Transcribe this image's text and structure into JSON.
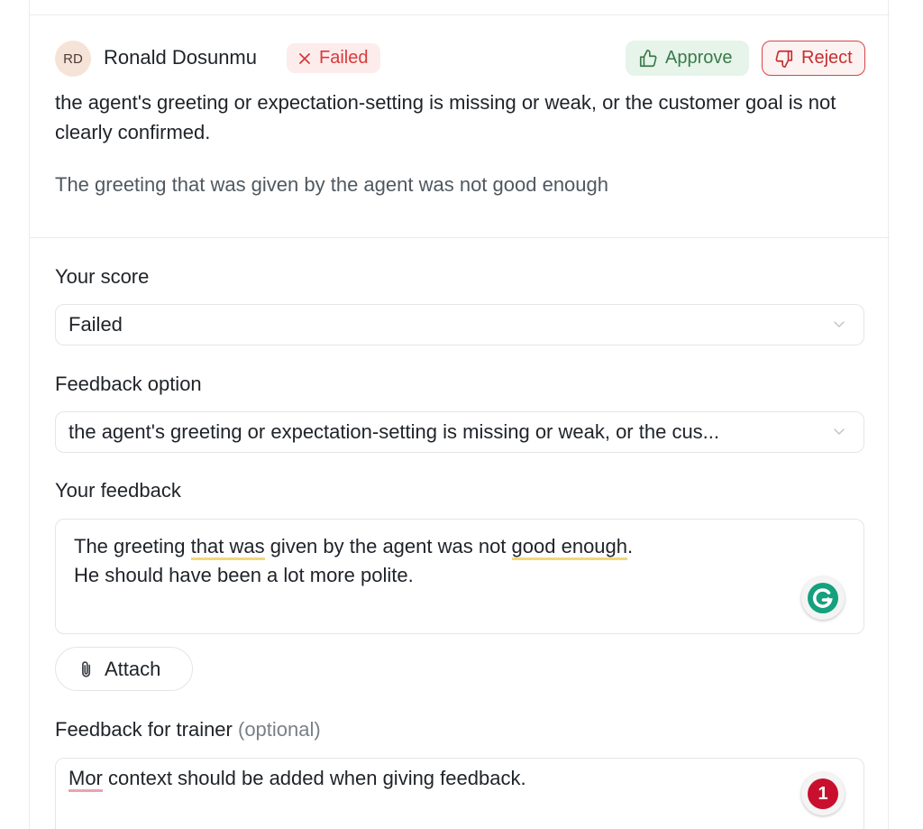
{
  "review": {
    "author_initials": "RD",
    "author_name": "Ronald Dosunmu",
    "status": "Failed",
    "status_icon": "close-icon",
    "approve_label": "Approve",
    "approve_icon": "thumbs-up-icon",
    "reject_label": "Reject",
    "reject_icon": "thumbs-down-icon",
    "headline": "the agent's greeting or expectation-setting is missing or weak, or the customer goal is not clearly confirmed.",
    "comment": "The greeting that was given by the agent was not good enough"
  },
  "form": {
    "score_label": "Your score",
    "score_value": "Failed",
    "feedback_option_label": "Feedback option",
    "feedback_option_value": "the agent's greeting or expectation-setting is missing or weak, or the cus...",
    "your_feedback_label": "Your feedback",
    "your_feedback": {
      "line1_a": "The greeting ",
      "line1_b": "that was",
      "line1_c": " given by the agent was not ",
      "line1_d": "good enough",
      "line1_e": ".",
      "line2": "He should have been a lot more polite."
    },
    "attach_label": "Attach",
    "attach_icon": "paperclip-icon",
    "trainer_label": "Feedback for trainer",
    "trainer_optional": "(optional)",
    "trainer_feedback": {
      "word": "Mor",
      "rest": " context should be added when giving feedback."
    },
    "grammarly_issue_count": "1"
  },
  "colors": {
    "approve_bg": "#e6f4ea",
    "reject_border": "#d64545",
    "failed_badge_bg": "#fdecec",
    "grammarly_green": "#15a07e",
    "grammarly_issue_red": "#c8102e"
  }
}
